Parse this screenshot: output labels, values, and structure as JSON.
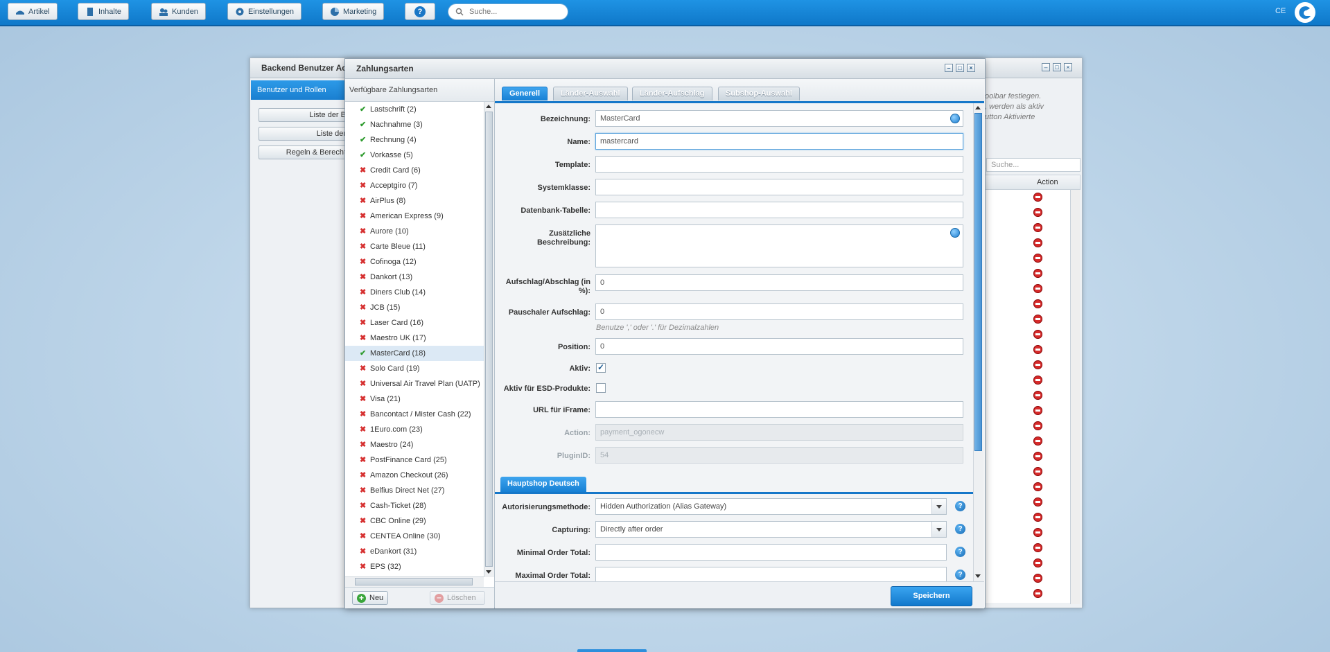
{
  "topbar": {
    "buttons": [
      {
        "label": "Artikel",
        "icon": "article-icon"
      },
      {
        "label": "Inhalte",
        "icon": "document-icon"
      },
      {
        "label": "Kunden",
        "icon": "customers-icon"
      },
      {
        "label": "Einstellungen",
        "icon": "gear-icon"
      },
      {
        "label": "Marketing",
        "icon": "chart-pie-icon"
      },
      {
        "label": "?",
        "icon": "help-icon"
      }
    ],
    "search_placeholder": "Suche...",
    "user_label": "CE"
  },
  "back_window": {
    "title": "Backend Benutzer Ac",
    "nav_item": "Benutzer und Rollen",
    "side_buttons": [
      "Liste der B",
      "Liste der",
      "Regeln & Berecht"
    ],
    "info_text": [
      "oolbar festlegen.",
      ", werden als aktiv",
      "utton Aktivierte"
    ],
    "search_placeholder": "Suche...",
    "grid_action_header": "Action"
  },
  "main_window": {
    "title": "Zahlungsarten",
    "list_header": "Verfügbare Zahlungsarten",
    "items": [
      {
        "label": "Lastschrift (2)",
        "active": true
      },
      {
        "label": "Nachnahme (3)",
        "active": true
      },
      {
        "label": "Rechnung (4)",
        "active": true
      },
      {
        "label": "Vorkasse (5)",
        "active": true
      },
      {
        "label": "Credit Card (6)",
        "active": false
      },
      {
        "label": "Acceptgiro (7)",
        "active": false
      },
      {
        "label": "AirPlus (8)",
        "active": false
      },
      {
        "label": "American Express (9)",
        "active": false
      },
      {
        "label": "Aurore (10)",
        "active": false
      },
      {
        "label": "Carte Bleue (11)",
        "active": false
      },
      {
        "label": "Cofinoga (12)",
        "active": false
      },
      {
        "label": "Dankort (13)",
        "active": false
      },
      {
        "label": "Diners Club (14)",
        "active": false
      },
      {
        "label": "JCB (15)",
        "active": false
      },
      {
        "label": "Laser Card (16)",
        "active": false
      },
      {
        "label": "Maestro UK (17)",
        "active": false
      },
      {
        "label": "MasterCard (18)",
        "active": true,
        "selected": true
      },
      {
        "label": "Solo Card (19)",
        "active": false
      },
      {
        "label": "Universal Air Travel Plan (UATP)",
        "active": false
      },
      {
        "label": "Visa (21)",
        "active": false
      },
      {
        "label": "Bancontact / Mister Cash (22)",
        "active": false
      },
      {
        "label": "1Euro.com (23)",
        "active": false
      },
      {
        "label": "Maestro (24)",
        "active": false
      },
      {
        "label": "PostFinance Card (25)",
        "active": false
      },
      {
        "label": "Amazon Checkout (26)",
        "active": false
      },
      {
        "label": "Belfius Direct Net (27)",
        "active": false
      },
      {
        "label": "Cash-Ticket (28)",
        "active": false
      },
      {
        "label": "CBC Online (29)",
        "active": false
      },
      {
        "label": "CENTEA Online (30)",
        "active": false
      },
      {
        "label": "eDankort (31)",
        "active": false
      },
      {
        "label": "EPS (32)",
        "active": false
      }
    ],
    "new_button": "Neu",
    "delete_button": "Löschen",
    "tabs": [
      "Generell",
      "Länder-Auswahl",
      "Länder-Aufschlag",
      "Subshop-Auswahl"
    ],
    "form": {
      "bezeichnung_label": "Bezeichnung:",
      "bezeichnung_value": "MasterCard",
      "name_label": "Name:",
      "name_value": "mastercard",
      "template_label": "Template:",
      "template_value": "",
      "systemklasse_label": "Systemklasse:",
      "systemklasse_value": "",
      "db_label": "Datenbank-Tabelle:",
      "db_value": "",
      "desc_label_1": "Zusätzliche",
      "desc_label_2": "Beschreibung:",
      "aufschlag_label_1": "Aufschlag/Abschlag (in",
      "aufschlag_label_2": "%):",
      "aufschlag_value": "0",
      "pauschal_label": "Pauschaler Aufschlag:",
      "pauschal_value": "0",
      "pauschal_hint": "Benutze ',' oder '.' für Dezimalzahlen",
      "position_label": "Position:",
      "position_value": "0",
      "aktiv_label": "Aktiv:",
      "aktiv_checked": true,
      "esd_label": "Aktiv für ESD-Produkte:",
      "esd_checked": false,
      "iframe_label": "URL für iFrame:",
      "iframe_value": "",
      "action_label": "Action:",
      "action_value": "payment_ogonecw",
      "plugin_label": "PluginID:",
      "plugin_value": "54",
      "section_title": "Hauptshop Deutsch",
      "auth_label": "Autorisierungsmethode:",
      "auth_value": "Hidden Authorization (Alias Gateway)",
      "capturing_label": "Capturing:",
      "capturing_value": "Directly after order",
      "min_total_label": "Minimal Order Total:",
      "min_total_value": "",
      "max_total_label": "Maximal Order Total:"
    },
    "save_button": "Speichern"
  }
}
